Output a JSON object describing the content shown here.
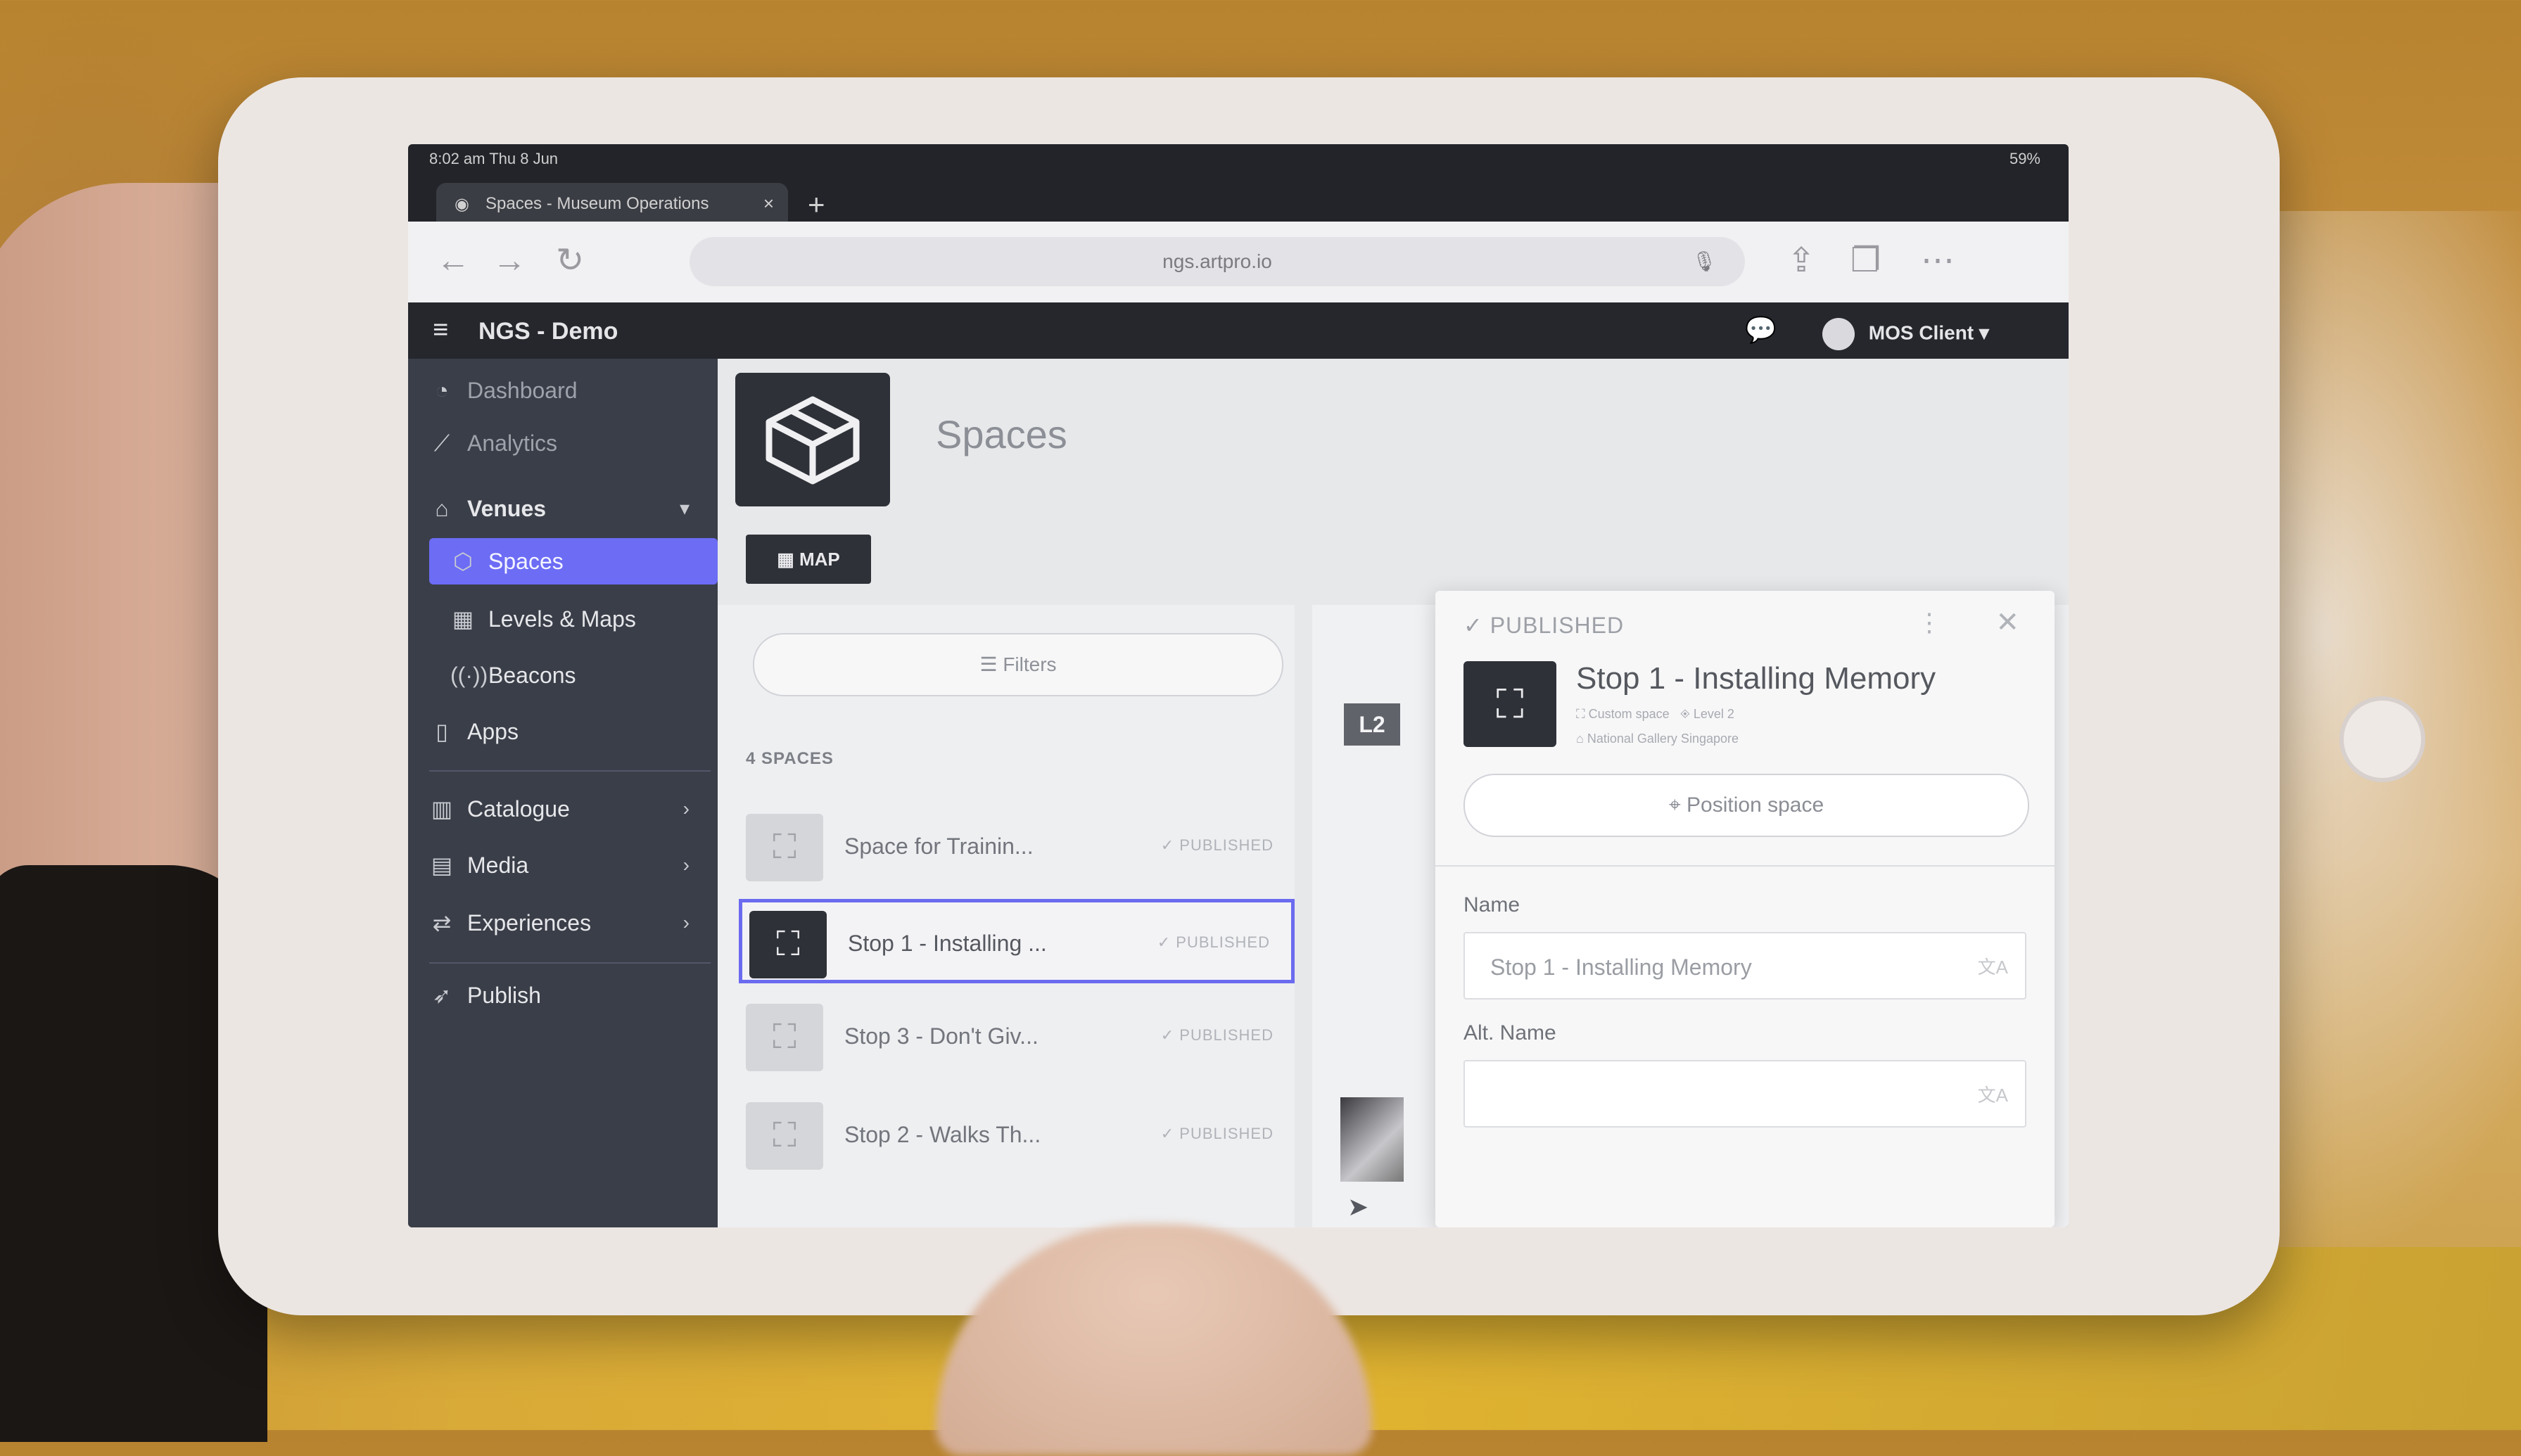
{
  "browser": {
    "status_time": "8:02 am  Thu 8 Jun",
    "battery": "59%",
    "tab_title": "Spaces - Museum Operations",
    "new_tab": "+",
    "url": "ngs.artpro.io"
  },
  "app": {
    "title": "NGS - Demo",
    "user": "MOS Client"
  },
  "sidebar": {
    "items": [
      {
        "label": "Dashboard",
        "icon": "dashboard-icon"
      },
      {
        "label": "Analytics",
        "icon": "chart-icon"
      },
      {
        "label": "Venues",
        "icon": "venue-icon"
      },
      {
        "label": "Spaces",
        "icon": "spaces-icon"
      },
      {
        "label": "Levels & Maps",
        "icon": "levels-icon"
      },
      {
        "label": "Beacons",
        "icon": "beacon-icon"
      },
      {
        "label": "Apps",
        "icon": "phone-icon"
      },
      {
        "label": "Catalogue",
        "icon": "book-icon"
      },
      {
        "label": "Media",
        "icon": "media-icon"
      },
      {
        "label": "Experiences",
        "icon": "route-icon"
      },
      {
        "label": "Publish",
        "icon": "publish-icon"
      }
    ]
  },
  "page": {
    "title": "Spaces",
    "map_button": "MAP",
    "filters_label": "Filters",
    "count_label": "4 SPACES"
  },
  "spaces": [
    {
      "name": "Space for Trainin...",
      "status": "PUBLISHED"
    },
    {
      "name": "Stop 1 - Installing ...",
      "status": "PUBLISHED"
    },
    {
      "name": "Stop 3 - Don't Giv...",
      "status": "PUBLISHED"
    },
    {
      "name": "Stop 2 - Walks Th...",
      "status": "PUBLISHED"
    }
  ],
  "map": {
    "level_label": "L2"
  },
  "detail": {
    "status": "PUBLISHED",
    "title": "Stop 1 - Installing Memory",
    "type": "Custom space",
    "level": "Level 2",
    "venue": "National Gallery Singapore",
    "position_button": "Position space",
    "name_label": "Name",
    "name_value": "Stop 1 - Installing Memory",
    "alt_name_label": "Alt. Name",
    "alt_name_value": ""
  },
  "colors": {
    "accent": "#6c6cf5",
    "sidebar_bg": "#3a3e48",
    "appbar_bg": "#25272d"
  }
}
